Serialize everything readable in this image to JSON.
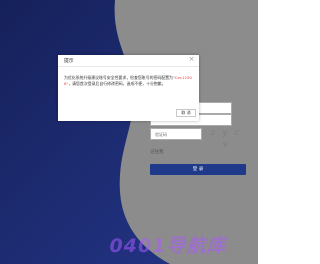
{
  "dialog": {
    "title": "提示",
    "message_part1": "为优化系统升级建议账号安全性要求，检查您账号的密码配置为",
    "password": "\"Cec12306\"",
    "message_part2": "，请您首次登录后自行修改密码，造成不便，十分抱歉。",
    "cancel_label": "取 消"
  },
  "login_form": {
    "captcha_placeholder": "验证码",
    "captcha_text": "z y c v",
    "remember_label": "记住我",
    "login_label": "登 录"
  },
  "watermark": {
    "text": "0401导航库"
  },
  "colors": {
    "navy": "#1b2a6e",
    "dark_navy": "#101c55",
    "grey_panel": "#8e8e8e",
    "login_button": "#1f3a8a",
    "password_red": "#e54545"
  }
}
